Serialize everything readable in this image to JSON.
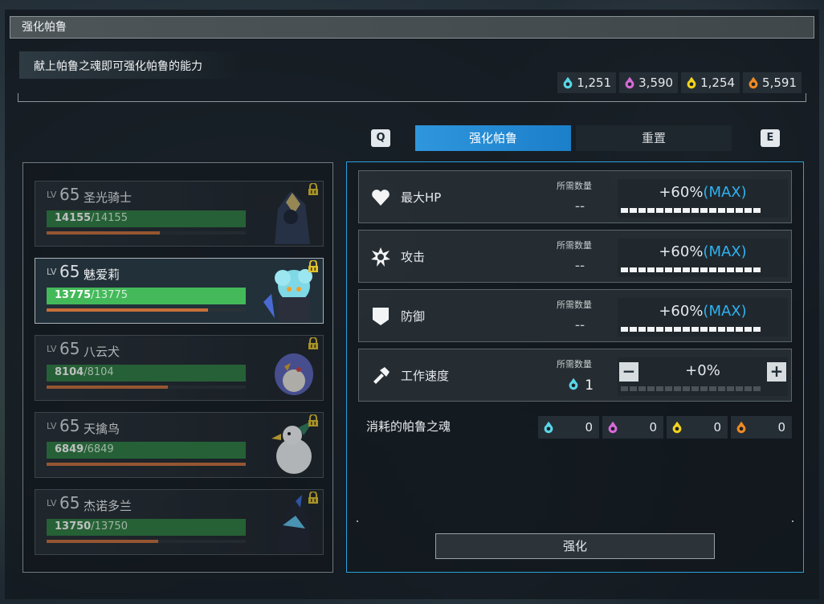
{
  "window": {
    "title": "强化帕鲁"
  },
  "description": "献上帕鲁之魂即可强化帕鲁的能力",
  "currencies": [
    {
      "icon": "soul-cyan-icon",
      "color": "#59d6e8",
      "value": "1,251"
    },
    {
      "icon": "soul-pink-icon",
      "color": "#d66ad8",
      "value": "3,590"
    },
    {
      "icon": "soul-yellow-icon",
      "color": "#f2d21c",
      "value": "1,254"
    },
    {
      "icon": "soul-orange-icon",
      "color": "#f08a22",
      "value": "5,591"
    }
  ],
  "tabs": {
    "prev_key": "Q",
    "next_key": "E",
    "items": [
      {
        "label": "强化帕鲁",
        "active": true
      },
      {
        "label": "重置",
        "active": false
      }
    ]
  },
  "pals": [
    {
      "lv_label": "LV",
      "level": "65",
      "name": "圣光骑士",
      "hp": "14155",
      "hp_max": "/14155",
      "xp_fraction": 0.57,
      "selected": false
    },
    {
      "lv_label": "LV",
      "level": "65",
      "name": "魅爱莉",
      "hp": "13775",
      "hp_max": "/13775",
      "xp_fraction": 0.81,
      "selected": true
    },
    {
      "lv_label": "LV",
      "level": "65",
      "name": "八云犬",
      "hp": "8104",
      "hp_max": "/8104",
      "xp_fraction": 0.61,
      "selected": false
    },
    {
      "lv_label": "LV",
      "level": "65",
      "name": "天擒鸟",
      "hp": "6849",
      "hp_max": "/6849",
      "xp_fraction": 1.0,
      "selected": false
    },
    {
      "lv_label": "LV",
      "level": "65",
      "name": "杰诺多兰",
      "hp": "13750",
      "hp_max": "/13750",
      "xp_fraction": 0.56,
      "selected": false
    }
  ],
  "stats": [
    {
      "icon": "heart-icon",
      "name": "最大HP",
      "req_label": "所需数量",
      "req_value": "--",
      "value": "+60%",
      "max_tag": "(MAX)",
      "filled_segments": 16,
      "total_segments": 16,
      "stepper": false
    },
    {
      "icon": "burst-icon",
      "name": "攻击",
      "req_label": "所需数量",
      "req_value": "--",
      "value": "+60%",
      "max_tag": "(MAX)",
      "filled_segments": 16,
      "total_segments": 16,
      "stepper": false
    },
    {
      "icon": "shield-icon",
      "name": "防御",
      "req_label": "所需数量",
      "req_value": "--",
      "value": "+60%",
      "max_tag": "(MAX)",
      "filled_segments": 16,
      "total_segments": 16,
      "stepper": false
    },
    {
      "icon": "hammer-icon",
      "name": "工作速度",
      "req_label": "所需数量",
      "req_value": "1",
      "req_icon": "soul-cyan-icon",
      "value": "+0%",
      "max_tag": "",
      "filled_segments": 0,
      "total_segments": 16,
      "stepper": true,
      "minus": "−",
      "plus": "+"
    }
  ],
  "consume": {
    "label": "消耗的帕鲁之魂",
    "items": [
      {
        "icon": "soul-cyan-icon",
        "color": "#59d6e8",
        "value": "0"
      },
      {
        "icon": "soul-pink-icon",
        "color": "#d66ad8",
        "value": "0"
      },
      {
        "icon": "soul-yellow-icon",
        "color": "#f2d21c",
        "value": "0"
      },
      {
        "icon": "soul-orange-icon",
        "color": "#f08a22",
        "value": "0"
      }
    ]
  },
  "enhance_button": "强化"
}
